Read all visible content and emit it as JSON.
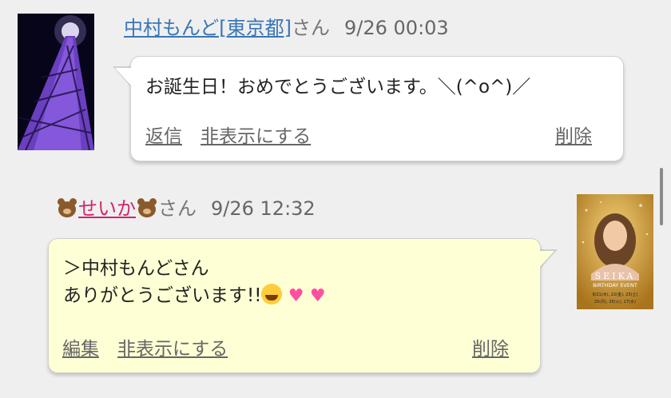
{
  "comments": [
    {
      "author": "中村もんど[東京都]",
      "suffix": "さん",
      "timestamp": "9/26 00:03",
      "message": "お誕生日！おめでとうございます。＼(^o^)／",
      "actions": {
        "reply": "返信",
        "hide": "非表示にする",
        "delete": "削除"
      }
    },
    {
      "author": "せいか",
      "suffix": "さん",
      "timestamp": "9/26 12:32",
      "message_line1": "＞中村もんどさん",
      "message_line2": "ありがとうございます!!",
      "actions": {
        "edit": "編集",
        "hide": "非表示にする",
        "delete": "削除"
      }
    }
  ],
  "poster": {
    "title": "SEIKA",
    "subtitle": "BIRTHDAY EVENT",
    "dates_line1": "9/21(木), 22(金), 23(土)",
    "dates_line2": "25(月), 26(火), 27(水)"
  },
  "colors": {
    "background": "#efefef",
    "link_blue": "#3a76b8",
    "link_pink": "#d0256e",
    "reply_bubble": "#ffffd5"
  }
}
